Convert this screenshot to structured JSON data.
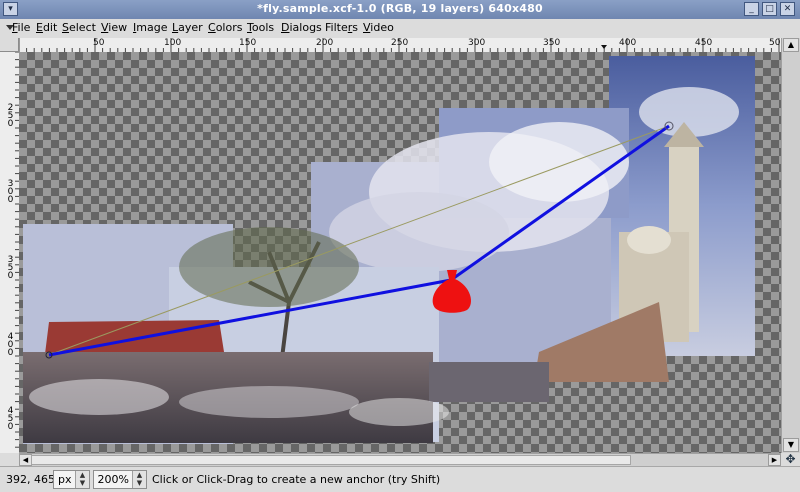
{
  "window": {
    "title": "*fly.sample.xcf-1.0 (RGB, 19 layers) 640x480"
  },
  "menubar": {
    "items": [
      {
        "pre": "",
        "u": "F",
        "post": "ile"
      },
      {
        "pre": "",
        "u": "E",
        "post": "dit"
      },
      {
        "pre": "",
        "u": "S",
        "post": "elect"
      },
      {
        "pre": "",
        "u": "V",
        "post": "iew"
      },
      {
        "pre": "",
        "u": "I",
        "post": "mage"
      },
      {
        "pre": "",
        "u": "L",
        "post": "ayer"
      },
      {
        "pre": "",
        "u": "C",
        "post": "olors"
      },
      {
        "pre": "",
        "u": "T",
        "post": "ools"
      },
      {
        "pre": "",
        "u": "D",
        "post": "ialogs"
      },
      {
        "pre": "Filte",
        "u": "r",
        "post": "s"
      },
      {
        "pre": "",
        "u": "V",
        "post": "ideo"
      }
    ]
  },
  "hruler": {
    "labels": [
      "50",
      "100",
      "150",
      "200",
      "250",
      "300",
      "350",
      "400",
      "450",
      "50"
    ]
  },
  "vruler": {
    "labels": [
      "250",
      "300",
      "350",
      "400",
      "450"
    ]
  },
  "statusbar": {
    "coords": "392, 465",
    "unit": "px",
    "zoom": "200%",
    "message": "Click or Click-Drag to create a new anchor (try Shift)"
  },
  "path": {
    "stroke_color": "#1010e0",
    "anchor_color": "#ee1111"
  }
}
